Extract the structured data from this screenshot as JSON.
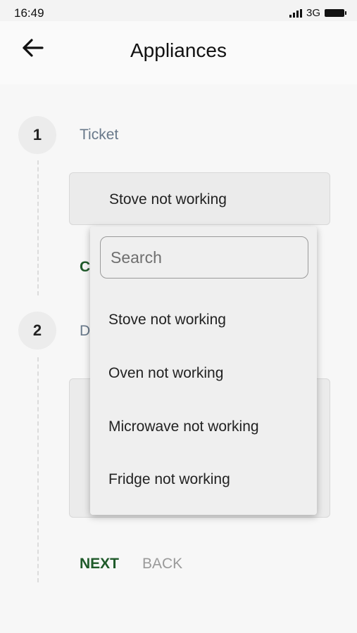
{
  "status_bar": {
    "time": "16:49",
    "network": "3G"
  },
  "header": {
    "title": "Appliances"
  },
  "steps": [
    {
      "number": "1",
      "label": "Ticket"
    },
    {
      "number": "2",
      "label": "D"
    }
  ],
  "ticket_select": {
    "value": "Stove not working",
    "partial_label": "C"
  },
  "dropdown": {
    "search_placeholder": "Search",
    "options": [
      "Stove not working",
      "Oven not working",
      "Microwave not working",
      "Fridge not working"
    ]
  },
  "actions": {
    "next_label": "NEXT",
    "back_label": "BACK"
  },
  "colors": {
    "accent": "#1f5a2a",
    "step_label": "#68788a",
    "window_edge": "#3b5bdb"
  }
}
